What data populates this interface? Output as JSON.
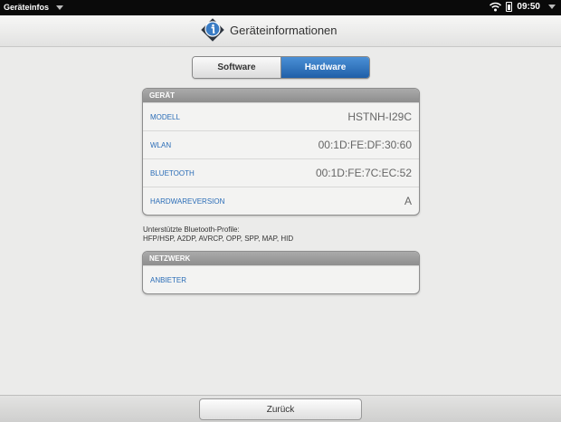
{
  "statusbar": {
    "app_name": "Geräteinfos",
    "time": "09:50"
  },
  "header": {
    "title": "Geräteinformationen"
  },
  "tabs": [
    {
      "label": "Software",
      "active": false
    },
    {
      "label": "Hardware",
      "active": true
    }
  ],
  "device_group": {
    "title": "GERÄT",
    "rows": [
      {
        "label": "MODELL",
        "value": "HSTNH-I29C"
      },
      {
        "label": "WLAN",
        "value": "00:1D:FE:DF:30:60"
      },
      {
        "label": "BLUETOOTH",
        "value": "00:1D:FE:7C:EC:52"
      },
      {
        "label": "HARDWAREVERSION",
        "value": "A"
      }
    ]
  },
  "bluetooth_note": {
    "line1": "Unterstützte Bluetooth-Profile:",
    "line2": "HFP/HSP, A2DP, AVRCP, OPP, SPP, MAP, HID"
  },
  "network_group": {
    "title": "NETZWERK",
    "rows": [
      {
        "label": "ANBIETER",
        "value": ""
      }
    ]
  },
  "footer": {
    "back_label": "Zurück"
  },
  "colors": {
    "accent": "#2b6db7",
    "active_tab": "#1f5fa8"
  }
}
